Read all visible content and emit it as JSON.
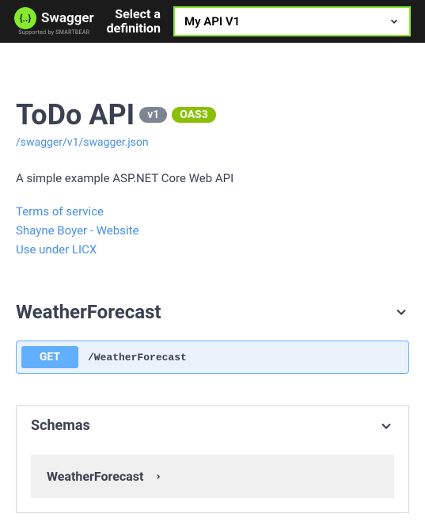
{
  "topbar": {
    "brand": "Swagger",
    "brand_sub": "Supported by SMARTBEAR",
    "def_label_line1": "Select a",
    "def_label_line2": "definition",
    "selected_definition": "My API V1"
  },
  "api": {
    "title": "ToDo API",
    "version_badge": "v1",
    "oas_badge": "OAS3",
    "swagger_url": "/swagger/v1/swagger.json",
    "description": "A simple example ASP.NET Core Web API",
    "links": {
      "tos": "Terms of service",
      "contact": "Shayne Boyer - Website",
      "license": "Use under LICX"
    }
  },
  "tag": {
    "name": "WeatherForecast",
    "operation": {
      "method": "GET",
      "path": "/WeatherForecast"
    }
  },
  "schemas": {
    "title": "Schemas",
    "items": [
      "WeatherForecast"
    ]
  }
}
